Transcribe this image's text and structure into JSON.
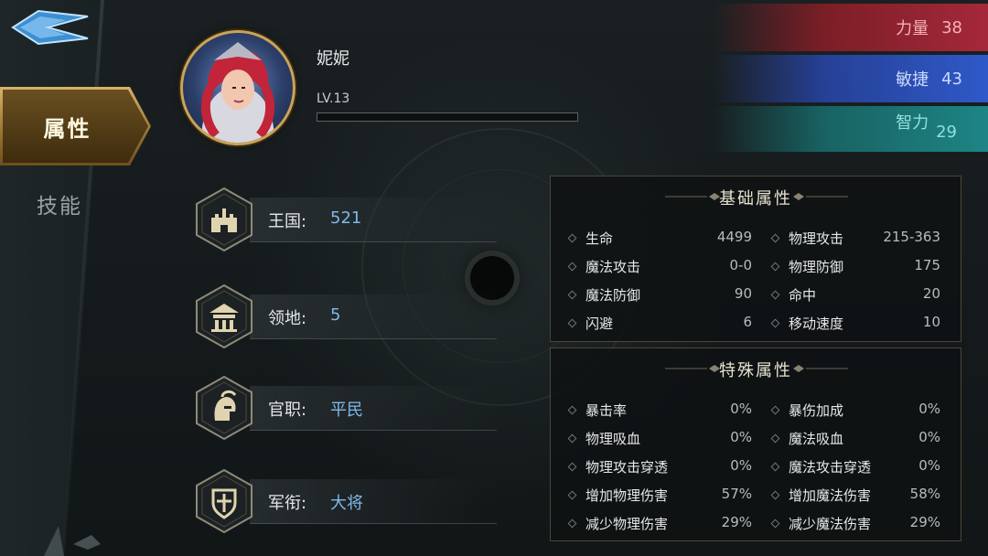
{
  "sidebar": {
    "tabs": [
      {
        "label": "属性",
        "active": true
      },
      {
        "label": "技能",
        "active": false
      }
    ]
  },
  "hero": {
    "name": "妮妮",
    "level": "LV.13",
    "xp_fraction": 0.0
  },
  "stats": {
    "strength": {
      "label": "力量",
      "value": "38",
      "color": "#a5283a"
    },
    "agility": {
      "label": "敏捷",
      "value": "43",
      "color": "#2f59c8"
    },
    "intellect": {
      "label": "智力",
      "value": "29",
      "color": "#1d8585"
    }
  },
  "info": [
    {
      "icon": "castle-icon",
      "label": "王国:",
      "value": "521"
    },
    {
      "icon": "territory-icon",
      "label": "领地:",
      "value": "5"
    },
    {
      "icon": "helmet-icon",
      "label": "官职:",
      "value": "平民"
    },
    {
      "icon": "shield-cross-icon",
      "label": "军衔:",
      "value": "大将"
    }
  ],
  "basic": {
    "title": "基础属性",
    "rows": [
      [
        {
          "name": "生命",
          "value": "4499"
        },
        {
          "name": "物理攻击",
          "value": "215-363"
        }
      ],
      [
        {
          "name": "魔法攻击",
          "value": "0-0"
        },
        {
          "name": "物理防御",
          "value": "175"
        }
      ],
      [
        {
          "name": "魔法防御",
          "value": "90"
        },
        {
          "name": "命中",
          "value": "20"
        }
      ],
      [
        {
          "name": "闪避",
          "value": "6"
        },
        {
          "name": "移动速度",
          "value": "10"
        }
      ]
    ]
  },
  "special": {
    "title": "特殊属性",
    "rows": [
      [
        {
          "name": "暴击率",
          "value": "0%"
        },
        {
          "name": "暴伤加成",
          "value": "0%"
        }
      ],
      [
        {
          "name": "物理吸血",
          "value": "0%"
        },
        {
          "name": "魔法吸血",
          "value": "0%"
        }
      ],
      [
        {
          "name": "物理攻击穿透",
          "value": "0%"
        },
        {
          "name": "魔法攻击穿透",
          "value": "0%"
        }
      ],
      [
        {
          "name": "增加物理伤害",
          "value": "57%"
        },
        {
          "name": "增加魔法伤害",
          "value": "58%"
        }
      ],
      [
        {
          "name": "减少物理伤害",
          "value": "29%"
        },
        {
          "name": "减少魔法伤害",
          "value": "29%"
        }
      ]
    ]
  },
  "colors": {
    "gold": "#c9a35a",
    "value_blue": "#7fb8e8"
  }
}
